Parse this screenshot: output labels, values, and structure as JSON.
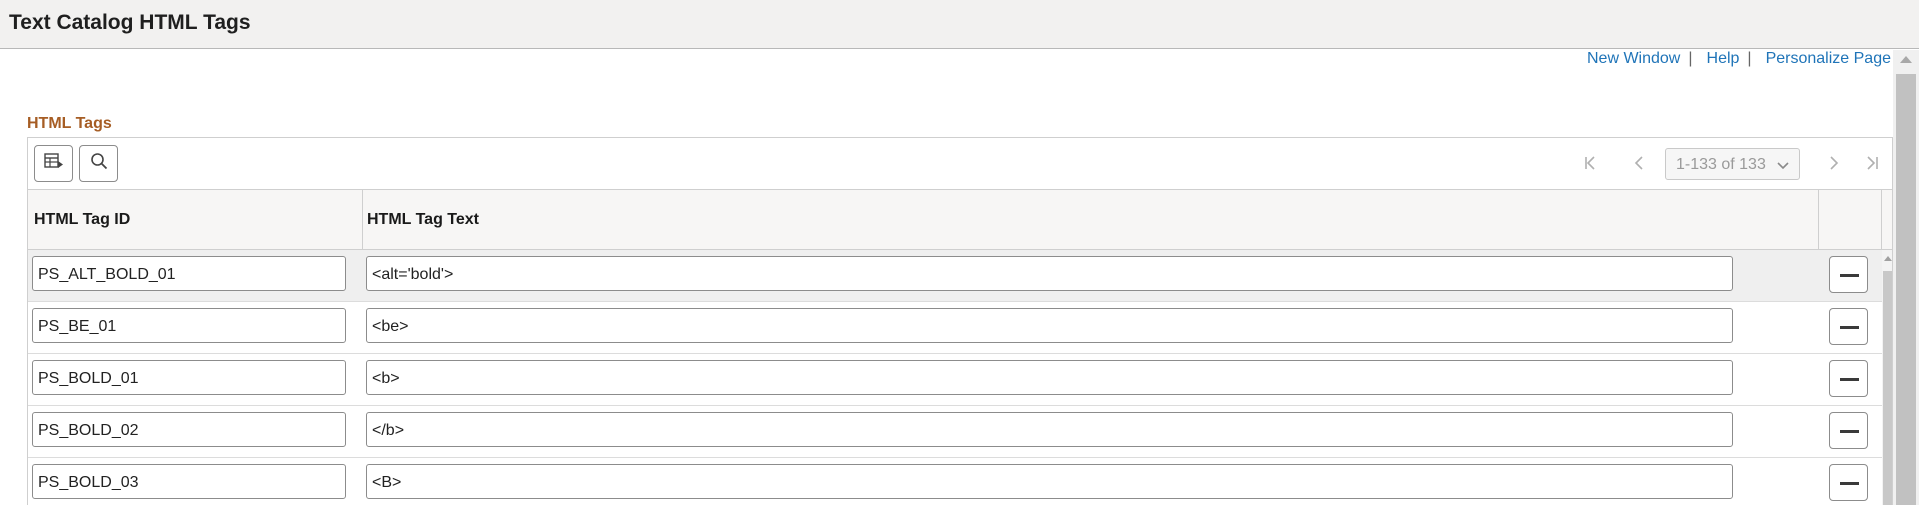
{
  "page": {
    "title": "Text Catalog HTML Tags"
  },
  "links": {
    "new_window": "New Window",
    "help": "Help",
    "personalize": "Personalize Page",
    "separator": "|"
  },
  "section": {
    "title": "HTML Tags"
  },
  "toolbar": {
    "view_icon": "grid-view-icon",
    "search_icon": "search-icon",
    "pager_text": "1-133 of 133"
  },
  "grid": {
    "headers": {
      "tag_id": "HTML Tag ID",
      "tag_text": "HTML Tag Text"
    },
    "rows": [
      {
        "tag_id": "PS_ALT_BOLD_01",
        "tag_text": "<alt='bold'>"
      },
      {
        "tag_id": "PS_BE_01",
        "tag_text": "<be>"
      },
      {
        "tag_id": "PS_BOLD_01",
        "tag_text": "<b>"
      },
      {
        "tag_id": "PS_BOLD_02",
        "tag_text": "</b>"
      },
      {
        "tag_id": "PS_BOLD_03",
        "tag_text": "<B>"
      }
    ]
  },
  "colors": {
    "link": "#1f74b8",
    "section_title": "#a65d24"
  }
}
